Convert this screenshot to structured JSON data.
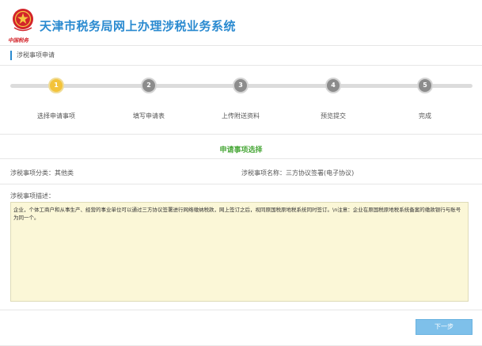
{
  "header": {
    "title": "天津市税务局网上办理涉税业务系统",
    "emblem_icon": "tax-emblem-icon",
    "emblem_text": "中国税务"
  },
  "section": {
    "title": "涉税事项申请"
  },
  "steps": [
    {
      "number": "1",
      "label": "选择申请事项",
      "active": true
    },
    {
      "number": "2",
      "label": "填写申请表",
      "active": false
    },
    {
      "number": "3",
      "label": "上传附送资料",
      "active": false
    },
    {
      "number": "4",
      "label": "预览提交",
      "active": false
    },
    {
      "number": "5",
      "label": "完成",
      "active": false
    }
  ],
  "selection": {
    "heading": "申请事项选择",
    "category_text": "涉税事项分类：其他类",
    "name_text": "涉税事项名称：三方协议签署(电子协议)"
  },
  "description": {
    "label": "涉税事项描述：",
    "text": "企业，个体工商户和从事生产、经营的事业单位可以通过三方协议签署进行网络缴纳税款，网上签订之后，视同原国税原地税系统同时签订。\\n注意：企业在原国税原地税系统备案的缴款银行与账号为同一个。"
  },
  "actions": {
    "next_label": "下一步"
  },
  "colors": {
    "brand_blue": "#2a8ad0",
    "active_step": "#f3c33a",
    "heading_green": "#4aa83a",
    "desc_bg": "#fbf7d7",
    "button": "#7ec0ea"
  }
}
